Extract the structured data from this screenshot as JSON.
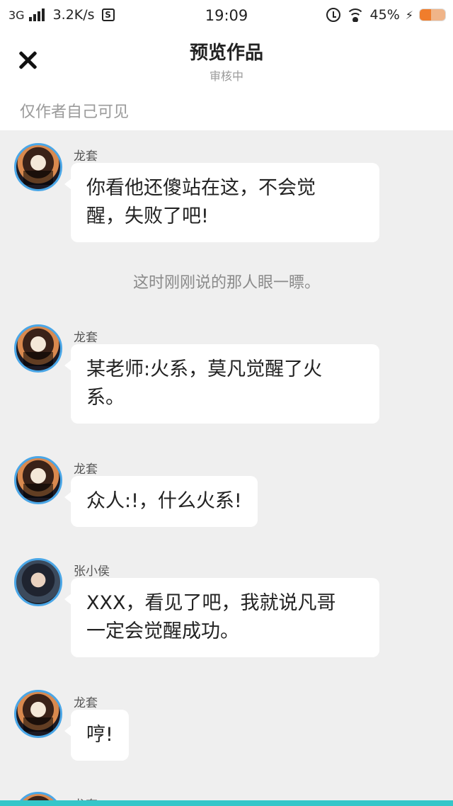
{
  "status_bar": {
    "network": "3G",
    "speed": "3.2K/s",
    "s_badge": "S",
    "time": "19:09",
    "battery": "45%",
    "battery_level": 0.45,
    "charging_symbol": "⚡"
  },
  "header": {
    "title": "预览作品",
    "subtitle": "审核中",
    "visibility_note": "仅作者自己可见",
    "close_icon": "close-icon"
  },
  "messages": [
    {
      "name": "龙套",
      "text_lines": [
        "你看他还傻站在这，不会觉",
        "醒，失败了吧!"
      ]
    },
    {
      "narration": "这时刚刚说的那人眼一瞟。"
    },
    {
      "name": "龙套",
      "text_lines": [
        "某老师:火系，莫凡觉醒了火",
        "系。"
      ]
    },
    {
      "name": "龙套",
      "text_lines": [
        "众人:!，什么火系!"
      ]
    },
    {
      "name": "张小侯",
      "text_lines": [
        "XXX，看见了吧，我就说凡哥",
        "一定会觉醒成功。"
      ]
    },
    {
      "name": "龙套",
      "text_lines": [
        "哼!"
      ]
    },
    {
      "name": "龙套"
    }
  ],
  "colors": {
    "avatar_ring": "#4aa6e6",
    "bottom_bar": "#35c6c9",
    "background": "#efefef"
  }
}
